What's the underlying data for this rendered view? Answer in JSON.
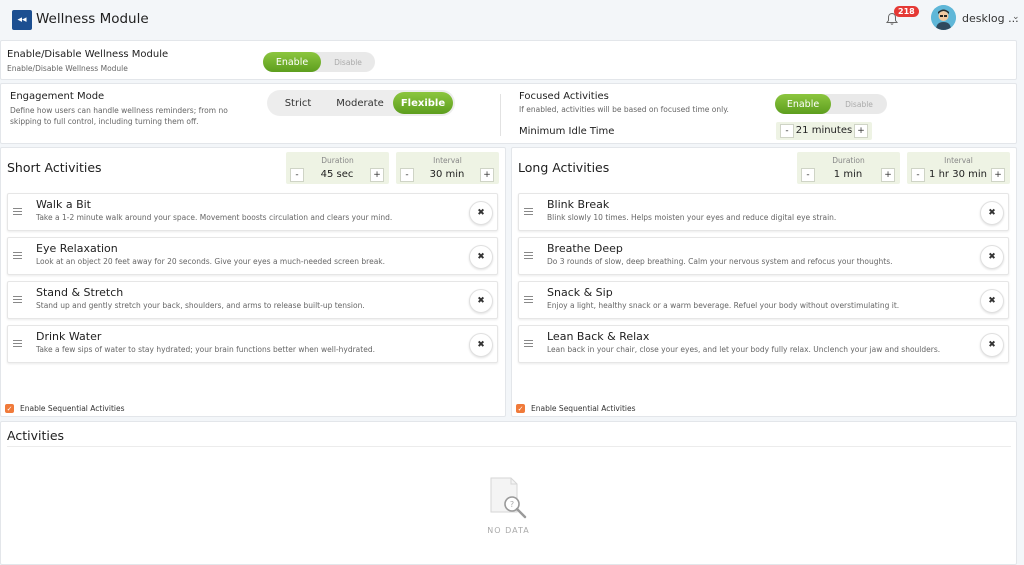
{
  "header": {
    "title": "Wellness Module",
    "notification_count": "218",
    "username": "desklog ..."
  },
  "module_toggle": {
    "title": "Enable/Disable Wellness Module",
    "subtitle": "Enable/Disable Wellness Module",
    "on_label": "Enable",
    "off_label": "Disable"
  },
  "engagement": {
    "title": "Engagement Mode",
    "subtitle": "Define how users can handle wellness reminders; from no skipping to full control, including turning them off.",
    "options": [
      "Strict",
      "Moderate",
      "Flexible"
    ],
    "selected": "Flexible"
  },
  "focused": {
    "title": "Focused Activities",
    "subtitle": "If enabled, activities will be based on focused time only.",
    "on_label": "Enable",
    "off_label": "Disable",
    "idle_label": "Minimum Idle Time",
    "idle_value": "21 minutes"
  },
  "short": {
    "title": "Short Activities",
    "duration_label": "Duration",
    "duration_value": "45 sec",
    "interval_label": "Interval",
    "interval_value": "30 min",
    "items": [
      {
        "name": "Walk a Bit",
        "desc": "Take a 1-2 minute walk around your space. Movement boosts circulation and clears your mind."
      },
      {
        "name": "Eye Relaxation",
        "desc": "Look at an object 20 feet away for 20 seconds. Give your eyes a much-needed screen break."
      },
      {
        "name": "Stand & Stretch",
        "desc": "Stand up and gently stretch your back, shoulders, and arms to release built-up tension."
      },
      {
        "name": "Drink Water",
        "desc": "Take a few sips of water to stay hydrated; your brain functions better when well-hydrated."
      }
    ],
    "sequential_label": "Enable Sequential Activities"
  },
  "long": {
    "title": "Long Activities",
    "duration_label": "Duration",
    "duration_value": "1 min",
    "interval_label": "Interval",
    "interval_value": "1 hr 30 min",
    "items": [
      {
        "name": "Blink Break",
        "desc": "Blink slowly 10 times. Helps moisten your eyes and reduce digital eye strain."
      },
      {
        "name": "Breathe Deep",
        "desc": "Do 3 rounds of slow, deep breathing. Calm your nervous system and refocus your thoughts."
      },
      {
        "name": "Snack & Sip",
        "desc": "Enjoy a light, healthy snack or a warm beverage. Refuel your body without overstimulating it."
      },
      {
        "name": "Lean Back & Relax",
        "desc": "Lean back in your chair, close your eyes, and let your body fully relax. Unclench your jaw and shoulders."
      }
    ],
    "sequential_label": "Enable Sequential Activities"
  },
  "activities": {
    "title": "Activities",
    "empty_text": "NO DATA"
  },
  "symbols": {
    "minus": "-",
    "plus": "+",
    "remove": "✖",
    "check": "✓",
    "back": "◂◂",
    "caret": "⌄"
  },
  "colors": {
    "accent_green": "#6fb02c",
    "brand_blue": "#1c4f91",
    "badge_red": "#e53935",
    "checkbox_orange": "#f07a3a"
  }
}
